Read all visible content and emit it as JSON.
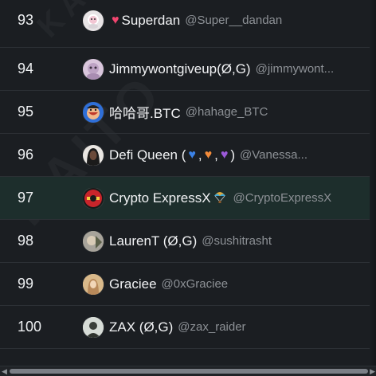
{
  "watermark": "KAITO",
  "rows": [
    {
      "rank": "93",
      "name": "Superdan",
      "handle": "@Super__dandan",
      "avatar": "avatar-superdan"
    },
    {
      "rank": "94",
      "name": "Jimmywontgiveup(Ø,G)",
      "handle": "@jimmywont...",
      "avatar": "avatar-jimmy"
    },
    {
      "rank": "95",
      "name": "哈哈哥.BTC",
      "handle": "@hahage_BTC",
      "avatar": "avatar-hahage"
    },
    {
      "rank": "96",
      "name": "Defi Queen (",
      "handle": "@Vanessa...",
      "sep": ",",
      "close": ")",
      "avatar": "avatar-defiqueen"
    },
    {
      "rank": "97",
      "name": "Crypto ExpressX",
      "handle": "@CryptoExpressX",
      "avatar": "avatar-cryptoexpress"
    },
    {
      "rank": "98",
      "name": "LaurenT (Ø,G)",
      "handle": "@sushitrasht",
      "avatar": "avatar-laurent"
    },
    {
      "rank": "99",
      "name": "Graciee",
      "handle": "@0xGraciee",
      "avatar": "avatar-graciee"
    },
    {
      "rank": "100",
      "name": "ZAX (Ø,G)",
      "handle": "@zax_raider",
      "avatar": "avatar-zax"
    }
  ],
  "colors": {
    "background": "#1b1e22",
    "highlight_row": "#1d2e2c",
    "handle": "#8d9196",
    "divider": "#2c3035"
  }
}
